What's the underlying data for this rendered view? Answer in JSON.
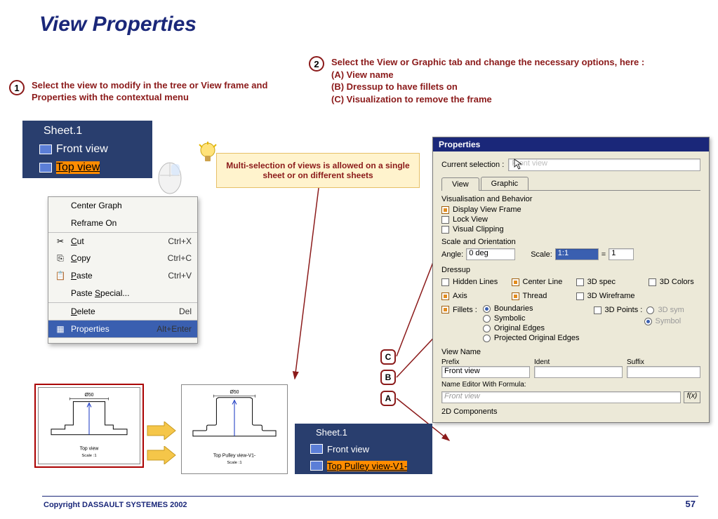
{
  "title": "View Properties",
  "steps": {
    "s1": {
      "num": "1",
      "text": "Select the view to modify in the tree or View frame and Properties with the contextual menu"
    },
    "s2": {
      "num": "2",
      "line1": "Select the View or Graphic tab and change the necessary options, here :",
      "a": " (A) View name",
      "b": " (B) Dressup to have fillets on",
      "c": " (C) Visualization to remove the frame"
    }
  },
  "tree1": {
    "sheet": "Sheet.1",
    "front": "Front view",
    "top": "Top view"
  },
  "ctx": {
    "centerGraph": "Center Graph",
    "reframe": "Reframe On",
    "cut": "Cut",
    "cutAcc": "Ctrl+X",
    "copy": "Copy",
    "copyAcc": "Ctrl+C",
    "paste": "Paste",
    "pasteAcc": "Ctrl+V",
    "pasteSpecial": "Paste Special...",
    "delete": "Delete",
    "deleteAcc": "Del",
    "properties": "Properties",
    "propertiesAcc": "Alt+Enter"
  },
  "tip": "Multi-selection of views is allowed on a single sheet or on different sheets",
  "callouts": {
    "a": "A",
    "b": "B",
    "c": "C"
  },
  "dialog": {
    "title": "Properties",
    "curSelLabel": "Current selection :",
    "curSelValue": "Front view",
    "tabs": {
      "view": "View",
      "graphic": "Graphic"
    },
    "vis": {
      "group": "Visualisation and Behavior",
      "displayFrame": "Display View Frame",
      "lockView": "Lock View",
      "visualClipping": "Visual Clipping"
    },
    "scale": {
      "group": "Scale and Orientation",
      "angleLbl": "Angle:",
      "angleVal": "0 deg",
      "scaleLbl": "Scale:",
      "scaleVal": "1:1",
      "eq": "=",
      "scaleNum": "1"
    },
    "dressup": {
      "group": "Dressup",
      "hidden": "Hidden Lines",
      "center": "Center Line",
      "spec3d": "3D spec",
      "colors3d": "3D Colors",
      "axis": "Axis",
      "thread": "Thread",
      "wire3d": "3D Wireframe",
      "fillets": "Fillets :",
      "boundaries": "Boundaries",
      "symbolic": "Symbolic",
      "origEdges": "Original Edges",
      "projOrig": "Projected Original Edges",
      "points3d": "3D Points :",
      "sym3d": "3D sym",
      "symbol": "Symbol"
    },
    "viewName": {
      "group": "View Name",
      "prefix": "Prefix",
      "ident": "Ident",
      "suffix": "Suffix",
      "prefixVal": "Front view",
      "formulaLbl": "Name Editor With Formula:",
      "formulaVal": "Front view",
      "fx": "f(x)"
    },
    "comp2d": "2D Components"
  },
  "tree2": {
    "sheet": "Sheet.1",
    "front": "Front view",
    "top": "Top Pulley view-V1-"
  },
  "draw": {
    "d1": {
      "dia": "Ø50",
      "label": "Top view",
      "scale": "Scale  :1"
    },
    "d2": {
      "dia": "Ø50",
      "label": "Top Pulley view-V1-",
      "scale": "Scale  :1"
    }
  },
  "footer": {
    "copy": "Copyright DASSAULT SYSTEMES 2002",
    "page": "57"
  }
}
